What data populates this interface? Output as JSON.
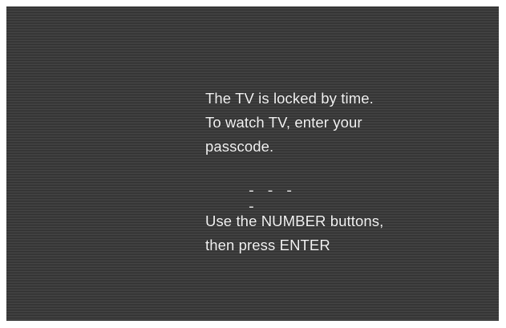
{
  "lock_message": {
    "lines": [
      "The TV is locked by time.",
      "To watch TV, enter your",
      "passcode."
    ]
  },
  "passcode": {
    "placeholder": "- - - -"
  },
  "instructions": {
    "lines": [
      "Use the NUMBER buttons,",
      "then press ENTER"
    ]
  }
}
